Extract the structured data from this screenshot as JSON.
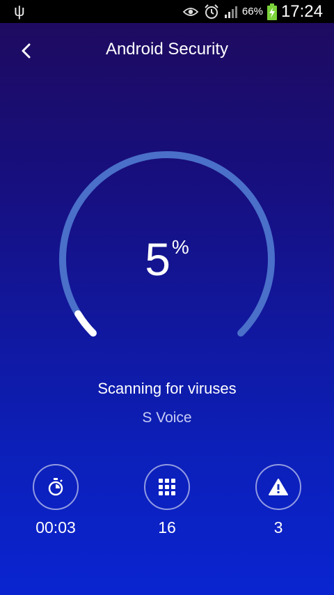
{
  "status_bar": {
    "battery_percent": "66%",
    "time": "17:24",
    "icons": [
      "usb-icon",
      "eye-icon",
      "alarm-icon",
      "signal-icon",
      "battery-charging-icon"
    ]
  },
  "header": {
    "title": "Android Security",
    "back_icon": "chevron-left-icon"
  },
  "scan": {
    "progress_value": "5",
    "progress_unit": "%",
    "progress_fraction": 0.05,
    "status": "Scanning for viruses",
    "current_item": "S Voice"
  },
  "stats": [
    {
      "icon": "stopwatch-icon",
      "value": "00:03"
    },
    {
      "icon": "grid-icon",
      "value": "16"
    },
    {
      "icon": "warning-icon",
      "value": "3"
    }
  ],
  "colors": {
    "background_top": "#1f0a5c",
    "background_bottom": "#0a24d0",
    "gauge_track": "#4a70c9",
    "gauge_progress": "#ffffff"
  }
}
